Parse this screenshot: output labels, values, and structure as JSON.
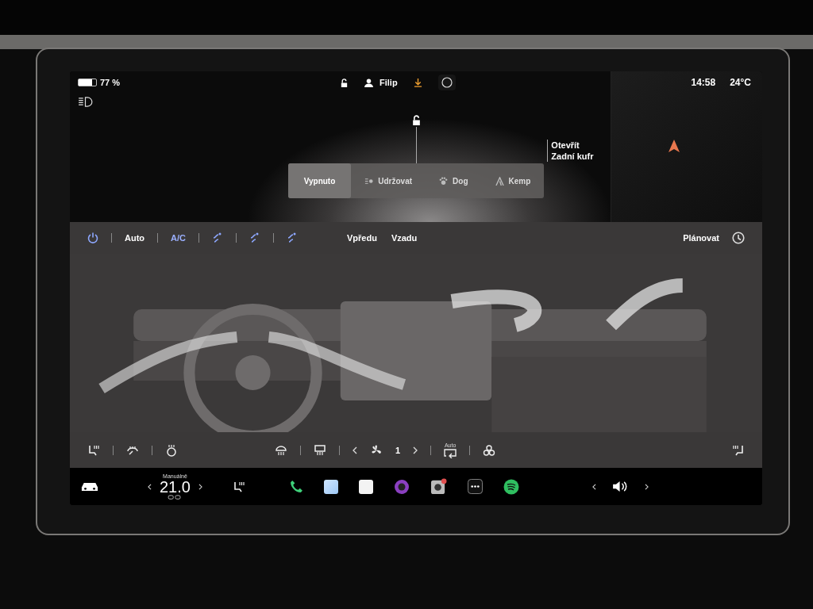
{
  "status_bar": {
    "battery": {
      "level": 0.77,
      "reading": "77 %"
    },
    "user": "Filip",
    "time": "14:58",
    "temperature": "24°C"
  },
  "trunk": {
    "lines": [
      "Otevřít",
      "Zadní kufr"
    ]
  },
  "modes": [
    {
      "label": "Vypnuto",
      "kind": "off",
      "selected": true
    },
    {
      "label": "Udržovat",
      "kind": "keep",
      "selected": false
    },
    {
      "label": "Dog",
      "kind": "dog",
      "selected": false
    },
    {
      "label": "Kemp",
      "kind": "camp",
      "selected": false
    }
  ],
  "climate": {
    "power": {
      "on": true
    },
    "controls": [
      {
        "kind": "text",
        "label": "Auto",
        "on": false
      },
      {
        "kind": "text",
        "label": "A/C",
        "on": true
      },
      {
        "kind": "vent",
        "on": true
      },
      {
        "kind": "vent",
        "on": true
      },
      {
        "kind": "vent",
        "on": true
      }
    ],
    "zones": [
      "Vpředu",
      "Vzadu"
    ],
    "schedule": "Plánovat",
    "fan_speed": "1",
    "recirculation": "Auto"
  },
  "dock": {
    "temperature_mode": "Manuálně",
    "temperature": "21.0"
  }
}
